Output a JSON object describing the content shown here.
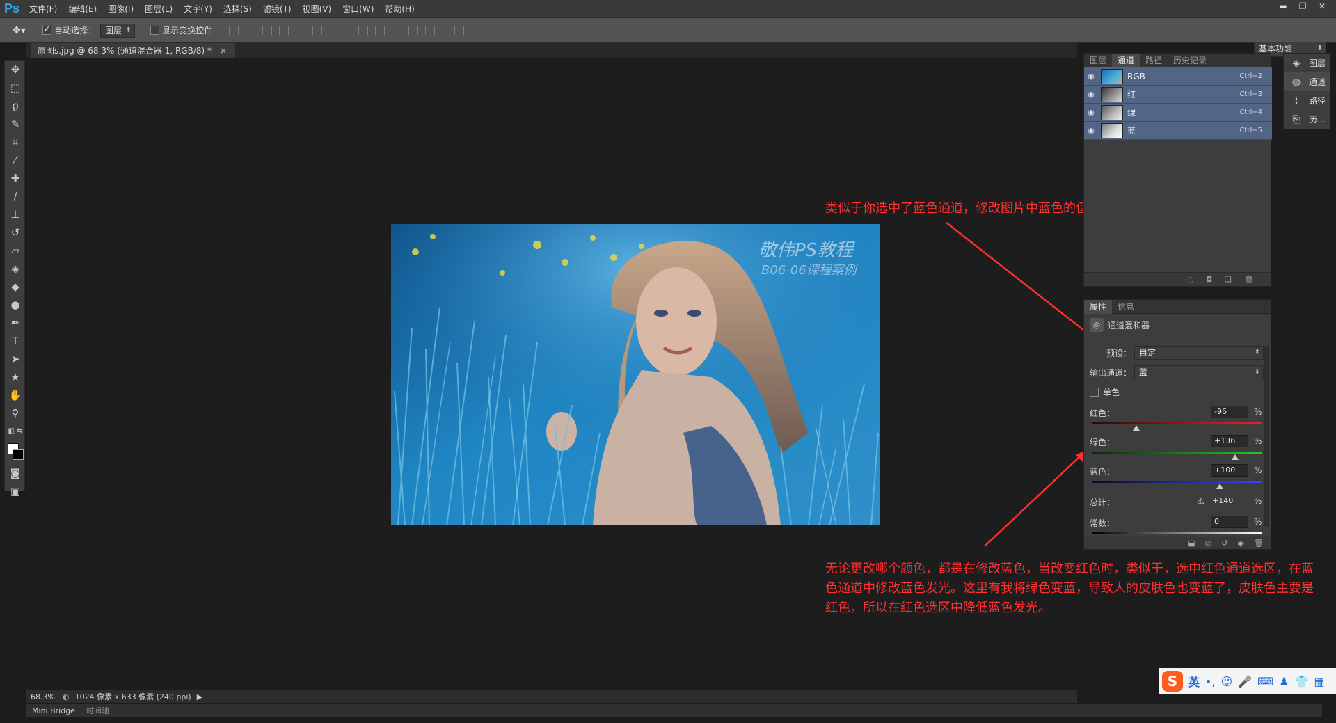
{
  "app": {
    "logo": "Ps",
    "menu": [
      "文件(F)",
      "编辑(E)",
      "图像(I)",
      "图层(L)",
      "文字(Y)",
      "选择(S)",
      "滤镜(T)",
      "视图(V)",
      "窗口(W)",
      "帮助(H)"
    ],
    "window_controls": [
      "▬",
      "❐",
      "✕"
    ]
  },
  "options": {
    "auto_select_label": "自动选择：",
    "auto_select_value": "图层",
    "show_transform_label": "显示变换控件",
    "workspace": "基本功能",
    "auto_select_checked": true
  },
  "document": {
    "tab_title": "原图s.jpg @ 68.3% (通道混合器 1, RGB/8) *",
    "close": "×",
    "watermark_line1": "敬伟PS教程",
    "watermark_line2": "B06-06课程案例"
  },
  "annotations": {
    "top": "类似于你选中了蓝色通道，修改图片中蓝色的值",
    "bottom": "无论更改哪个颜色，都是在修改蓝色，当改变红色时，类似于，选中红色通道选区，在蓝色通道中修改蓝色发光。这里有我将绿色变蓝，导致人的皮肤色也变蓝了，皮肤色主要是红色，所以在红色选区中降低蓝色发光。"
  },
  "channels_panel": {
    "tabs": [
      "图层",
      "通道",
      "路径",
      "历史记录"
    ],
    "active_tab": "通道",
    "channels": [
      {
        "name": "RGB",
        "shortcut": "Ctrl+2"
      },
      {
        "name": "红",
        "shortcut": "Ctrl+3"
      },
      {
        "name": "绿",
        "shortcut": "Ctrl+4"
      },
      {
        "name": "蓝",
        "shortcut": "Ctrl+5"
      }
    ]
  },
  "properties_panel": {
    "tabs": [
      "属性",
      "信息"
    ],
    "title": "通道混和器",
    "preset_label": "预设：",
    "preset_value": "自定",
    "output_label": "输出通道：",
    "output_value": "蓝",
    "mono_label": "单色",
    "mono_checked": false,
    "red_label": "红色：",
    "red_value": "-96",
    "green_label": "绿色：",
    "green_value": "+136",
    "blue_label": "蓝色：",
    "blue_value": "+100",
    "total_label": "总计：",
    "total_value": "+140",
    "const_label": "常数：",
    "const_value": "0",
    "percent": "%",
    "slider_levels": {
      "red": -96,
      "green": 136,
      "blue": 100,
      "const": 0,
      "range": [
        -200,
        200
      ]
    }
  },
  "dock": {
    "items": [
      "图层",
      "通道",
      "路径",
      "历..."
    ]
  },
  "status": {
    "zoom": "68.3%",
    "info": "1024 像素 x 633 像素 (240 ppi)"
  },
  "bottom_tabs": [
    "Mini Bridge",
    "时间轴"
  ],
  "ime": {
    "mode": "英"
  },
  "colors": {
    "annotation": "#ff3030",
    "channel_row": "#536584",
    "ps_blue": "#2fa3e6"
  }
}
